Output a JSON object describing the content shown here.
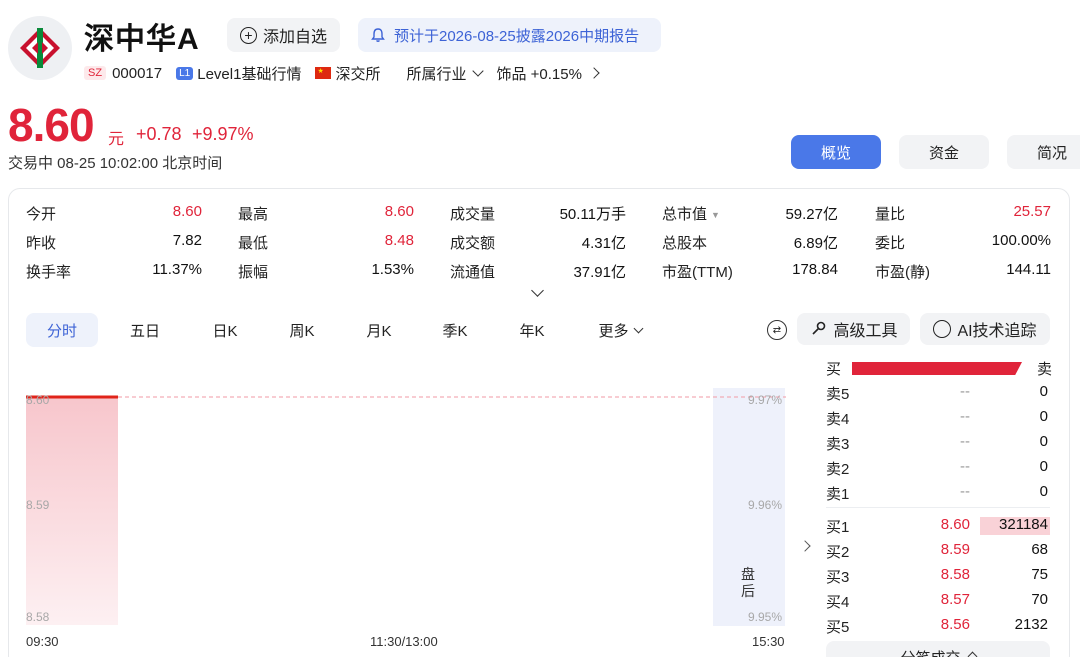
{
  "header": {
    "name": "深中华A",
    "watch_label": "添加自选",
    "notice": "预计于2026-08-25披露2026中期报告",
    "exchange_tag": "SZ",
    "code": "000017",
    "level_tag": "L1",
    "level_label": "Level1基础行情",
    "exchange_name": "深交所",
    "industry_label": "所属行业",
    "industry_value": "饰品 +0.15%"
  },
  "quote": {
    "price": "8.60",
    "unit": "元",
    "change": "+0.78",
    "change_pct": "+9.97%",
    "status": "交易中 08-25 10:02:00 北京时间"
  },
  "tabs": {
    "overview": "概览",
    "funds": "资金",
    "brief": "简况"
  },
  "stats": [
    [
      {
        "label": "今开",
        "value": "8.60"
      },
      {
        "label": "最高",
        "value": "8.60"
      },
      {
        "label": "成交量",
        "value": "50.11万手"
      },
      {
        "label": "总市值",
        "value": "59.27亿"
      },
      {
        "label": "量比",
        "value": "25.57"
      }
    ],
    [
      {
        "label": "昨收",
        "value": "7.82"
      },
      {
        "label": "最低",
        "value": "8.48"
      },
      {
        "label": "成交额",
        "value": "4.31亿"
      },
      {
        "label": "总股本",
        "value": "6.89亿"
      },
      {
        "label": "委比",
        "value": "100.00%"
      }
    ],
    [
      {
        "label": "换手率",
        "value": "11.37%"
      },
      {
        "label": "振幅",
        "value": "1.53%"
      },
      {
        "label": "流通值",
        "value": "37.91亿"
      },
      {
        "label": "市盈(TTM)",
        "value": "178.84"
      },
      {
        "label": "市盈(静)",
        "value": "144.11"
      }
    ]
  ],
  "kline_tabs": [
    "分时",
    "五日",
    "日K",
    "周K",
    "月K",
    "季K",
    "年K",
    "更多"
  ],
  "tools": {
    "advanced": "高级工具",
    "ai_tracking": "AI技术追踪"
  },
  "chart": {
    "left_axis": [
      "8.60",
      "8.59",
      "8.58"
    ],
    "right_axis": [
      "9.97%",
      "9.96%",
      "9.95%"
    ],
    "time_axis": [
      "09:30",
      "11:30/13:00",
      "15:30"
    ],
    "after_hours": "盘后"
  },
  "order_book": {
    "buy_label": "买",
    "sell_label": "卖",
    "asks": [
      {
        "label": "卖5",
        "price": "--",
        "volume": "0"
      },
      {
        "label": "卖4",
        "price": "--",
        "volume": "0"
      },
      {
        "label": "卖3",
        "price": "--",
        "volume": "0"
      },
      {
        "label": "卖2",
        "price": "--",
        "volume": "0"
      },
      {
        "label": "卖1",
        "price": "--",
        "volume": "0"
      }
    ],
    "bids": [
      {
        "label": "买1",
        "price": "8.60",
        "volume": "321184"
      },
      {
        "label": "买2",
        "price": "8.59",
        "volume": "68"
      },
      {
        "label": "买3",
        "price": "8.58",
        "volume": "75"
      },
      {
        "label": "买4",
        "price": "8.57",
        "volume": "70"
      },
      {
        "label": "买5",
        "price": "8.56",
        "volume": "2132"
      }
    ],
    "detail_label": "分笔成交"
  },
  "colors": {
    "up": "#e0243a",
    "accent": "#4a78e8"
  }
}
